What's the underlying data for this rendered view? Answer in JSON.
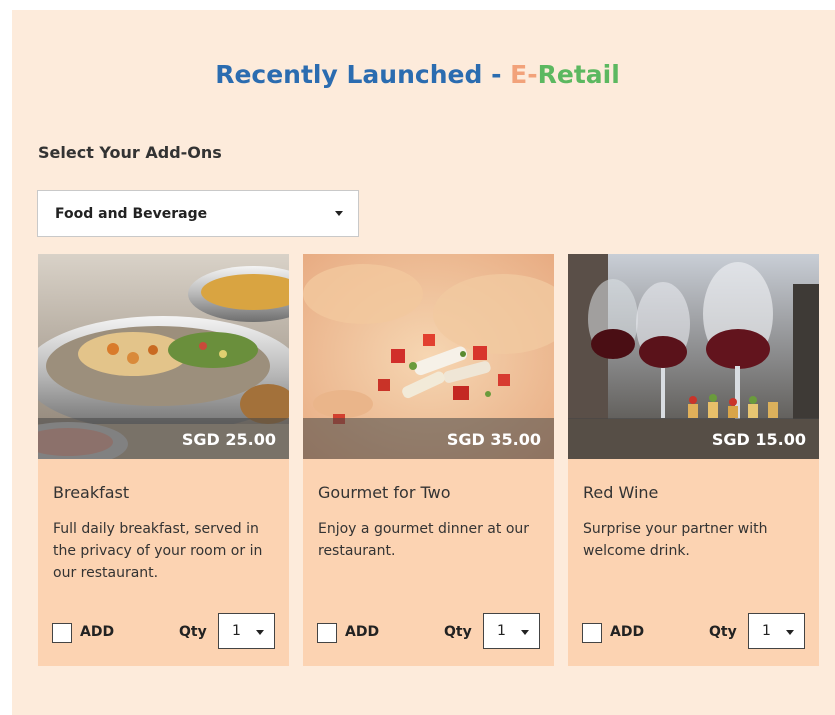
{
  "header": {
    "title_part1": "Recently Launched - ",
    "title_part2": "E-",
    "title_part3": "Retail"
  },
  "addons": {
    "label": "Select Your Add-Ons",
    "category_selected": "Food and Beverage"
  },
  "cards": [
    {
      "image": "buffet-chafing-dishes-photo",
      "price": "SGD 25.00",
      "name": "Breakfast",
      "description": "Full daily breakfast, served in the privacy of your room or in our restaurant.",
      "add_label": "ADD",
      "qty_label": "Qty",
      "qty_value": "1"
    },
    {
      "image": "gourmet-plated-dish-photo",
      "price": "SGD 35.00",
      "name": "Gourmet for Two",
      "description": "Enjoy a gourmet dinner at our restaurant.",
      "add_label": "ADD",
      "qty_label": "Qty",
      "qty_value": "1"
    },
    {
      "image": "red-wine-glasses-photo",
      "price": "SGD 15.00",
      "name": "Red Wine",
      "description": "Surprise your partner with welcome drink.",
      "add_label": "ADD",
      "qty_label": "Qty",
      "qty_value": "1"
    }
  ],
  "colors": {
    "panel_bg": "#fdebdb",
    "card_bg": "#fcd3b2",
    "title_blue": "#2b6cb0",
    "title_orange": "#f2a27a",
    "title_green": "#5cb860"
  }
}
